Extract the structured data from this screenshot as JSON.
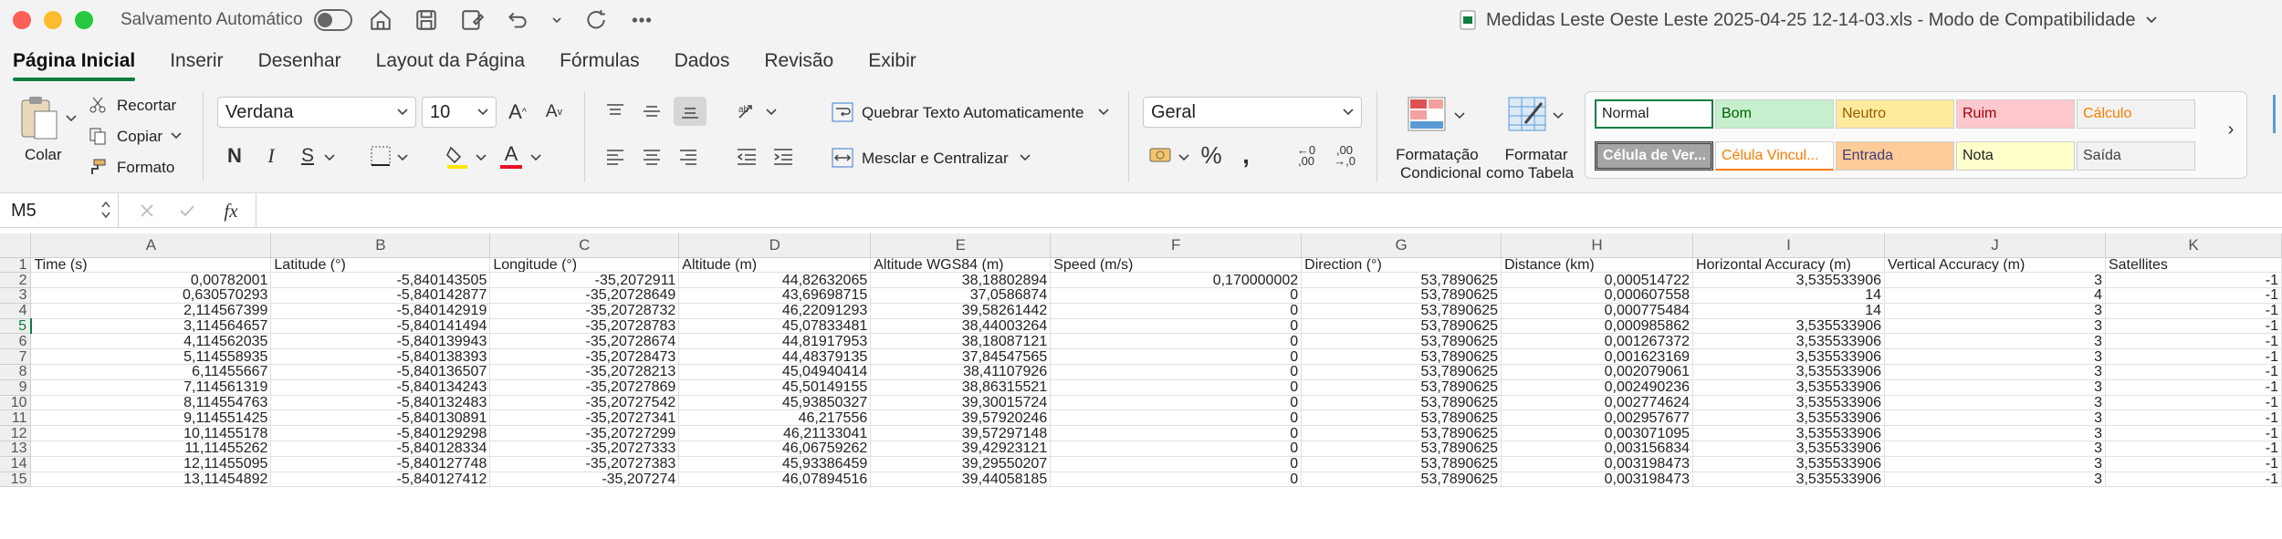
{
  "titlebar": {
    "autosave_label": "Salvamento Automático",
    "document_title": "Medidas Leste Oeste Leste 2025-04-25 12-14-03.xls  -  Modo de Compatibilidade"
  },
  "tabs": [
    "Página Inicial",
    "Inserir",
    "Desenhar",
    "Layout da Página",
    "Fórmulas",
    "Dados",
    "Revisão",
    "Exibir"
  ],
  "clipboard": {
    "paste": "Colar",
    "cut": "Recortar",
    "copy": "Copiar",
    "format": "Formato"
  },
  "font": {
    "name": "Verdana",
    "size": "10"
  },
  "alignment": {
    "wrap": "Quebrar Texto Automaticamente",
    "merge": "Mesclar e Centralizar"
  },
  "number": {
    "format": "Geral"
  },
  "styles_group": {
    "conditional": [
      "Formatação",
      "Condicional"
    ],
    "table": [
      "Formatar",
      "como Tabela"
    ]
  },
  "styles": [
    {
      "label": "Normal",
      "bg": "#ffffff",
      "color": "#222222"
    },
    {
      "label": "Bom",
      "bg": "#c6efce",
      "color": "#006100"
    },
    {
      "label": "Neutro",
      "bg": "#ffeb9c",
      "color": "#9c5700"
    },
    {
      "label": "Ruim",
      "bg": "#ffc7ce",
      "color": "#9c0006"
    },
    {
      "label": "Cálculo",
      "bg": "#f2f2f2",
      "color": "#fa7d00"
    },
    {
      "label": "Célula de Ver...",
      "bg": "#a5a5a5",
      "color": "#ffffff"
    },
    {
      "label": "Célula Vincul...",
      "bg": "#ffffff",
      "color": "#fa7d00"
    },
    {
      "label": "Entrada",
      "bg": "#ffcc99",
      "color": "#3f3f76"
    },
    {
      "label": "Nota",
      "bg": "#ffffcc",
      "color": "#222222"
    },
    {
      "label": "Saída",
      "bg": "#f2f2f2",
      "color": "#3f3f3f"
    }
  ],
  "formula_bar": {
    "name_box": "M5",
    "fx": "fx"
  },
  "sheet": {
    "columns": [
      "A",
      "B",
      "C",
      "D",
      "E",
      "F",
      "G",
      "H",
      "I",
      "J",
      "K"
    ],
    "header_row": [
      "Time (s)",
      "Latitude (°)",
      "Longitude (°)",
      "Altitude (m)",
      "Altitude WGS84 (m)",
      "Speed (m/s)",
      "Direction (°)",
      "Distance (km)",
      "Horizontal Accuracy (m)",
      "Vertical Accuracy (m)",
      "Satellites"
    ],
    "rows": [
      [
        "0,00782001",
        "-5,840143505",
        "-35,2072911",
        "44,82632065",
        "38,18802894",
        "0,170000002",
        "53,7890625",
        "0,000514722",
        "3,535533906",
        "3",
        "-1"
      ],
      [
        "0,630570293",
        "-5,840142877",
        "-35,20728649",
        "43,69698715",
        "37,0586874",
        "0",
        "53,7890625",
        "0,000607558",
        "14",
        "4",
        "-1"
      ],
      [
        "2,114567399",
        "-5,840142919",
        "-35,20728732",
        "46,22091293",
        "39,58261442",
        "0",
        "53,7890625",
        "0,000775484",
        "14",
        "3",
        "-1"
      ],
      [
        "3,114564657",
        "-5,840141494",
        "-35,20728783",
        "45,07833481",
        "38,44003264",
        "0",
        "53,7890625",
        "0,000985862",
        "3,535533906",
        "3",
        "-1"
      ],
      [
        "4,114562035",
        "-5,840139943",
        "-35,20728674",
        "44,81917953",
        "38,18087121",
        "0",
        "53,7890625",
        "0,001267372",
        "3,535533906",
        "3",
        "-1"
      ],
      [
        "5,114558935",
        "-5,840138393",
        "-35,20728473",
        "44,48379135",
        "37,84547565",
        "0",
        "53,7890625",
        "0,001623169",
        "3,535533906",
        "3",
        "-1"
      ],
      [
        "6,11455667",
        "-5,840136507",
        "-35,20728213",
        "45,04940414",
        "38,41107926",
        "0",
        "53,7890625",
        "0,002079061",
        "3,535533906",
        "3",
        "-1"
      ],
      [
        "7,114561319",
        "-5,840134243",
        "-35,20727869",
        "45,50149155",
        "38,86315521",
        "0",
        "53,7890625",
        "0,002490236",
        "3,535533906",
        "3",
        "-1"
      ],
      [
        "8,114554763",
        "-5,840132483",
        "-35,20727542",
        "45,93850327",
        "39,30015724",
        "0",
        "53,7890625",
        "0,002774624",
        "3,535533906",
        "3",
        "-1"
      ],
      [
        "9,114551425",
        "-5,840130891",
        "-35,20727341",
        "46,217556",
        "39,57920246",
        "0",
        "53,7890625",
        "0,002957677",
        "3,535533906",
        "3",
        "-1"
      ],
      [
        "10,11455178",
        "-5,840129298",
        "-35,20727299",
        "46,21133041",
        "39,57297148",
        "0",
        "53,7890625",
        "0,003071095",
        "3,535533906",
        "3",
        "-1"
      ],
      [
        "11,11455262",
        "-5,840128334",
        "-35,20727333",
        "46,06759262",
        "39,42923121",
        "0",
        "53,7890625",
        "0,003156834",
        "3,535533906",
        "3",
        "-1"
      ],
      [
        "12,11455095",
        "-5,840127748",
        "-35,20727383",
        "45,93386459",
        "39,29550207",
        "0",
        "53,7890625",
        "0,003198473",
        "3,535533906",
        "3",
        "-1"
      ],
      [
        "13,11454892",
        "-5,840127412",
        "-35,207274",
        "46,07894516",
        "39,44058185",
        "0",
        "53,7890625",
        "0,003198473",
        "3,535533906",
        "3",
        "-1"
      ]
    ]
  }
}
